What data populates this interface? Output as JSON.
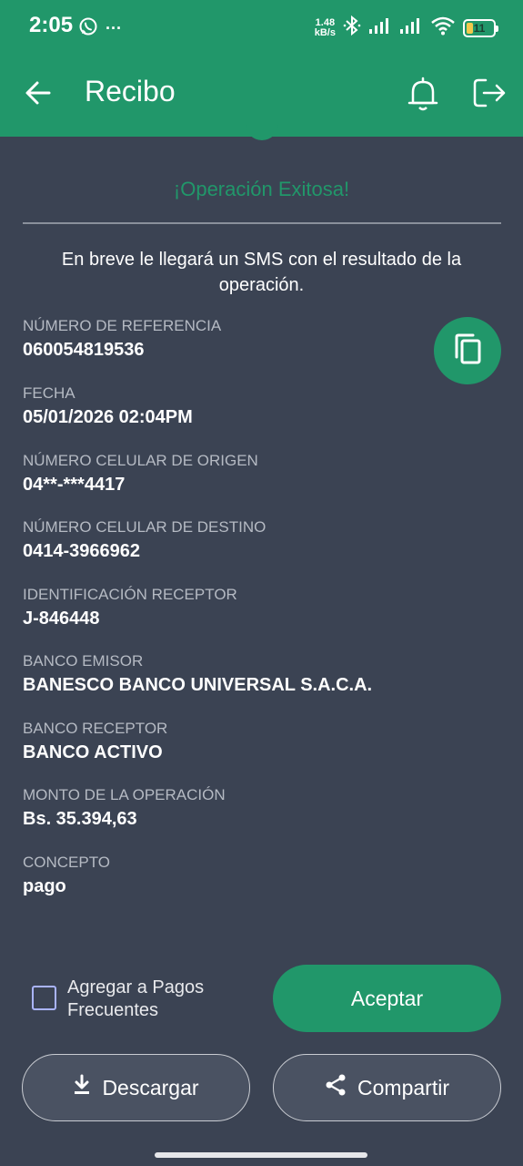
{
  "status_bar": {
    "time": "2:05",
    "more": "···",
    "net_speed_value": "1.48",
    "net_speed_unit": "kB/s",
    "battery_level": "11",
    "icons": [
      "whatsapp-icon",
      "bluetooth-icon",
      "signal-icon",
      "signal-icon",
      "wifi-icon",
      "battery-icon"
    ]
  },
  "app_bar": {
    "title": "Recibo",
    "icons": [
      "back-arrow-icon",
      "bell-icon",
      "logout-icon"
    ]
  },
  "receipt": {
    "success_title": "¡Operación Exitosa!",
    "sms_note": "En breve le llegará un SMS con el resultado de la operación.",
    "fields": [
      {
        "label": "NÚMERO DE REFERENCIA",
        "value": "060054819536"
      },
      {
        "label": "FECHA",
        "value": "05/01/2026 02:04PM"
      },
      {
        "label": "NÚMERO CELULAR DE ORIGEN",
        "value": "04**-***4417"
      },
      {
        "label": "NÚMERO CELULAR DE DESTINO",
        "value": "0414-3966962"
      },
      {
        "label": "IDENTIFICACIÓN RECEPTOR",
        "value": "J-846448"
      },
      {
        "label": "BANCO EMISOR",
        "value": "BANESCO BANCO UNIVERSAL S.A.C.A."
      },
      {
        "label": "BANCO RECEPTOR",
        "value": "BANCO ACTIVO"
      },
      {
        "label": "MONTO DE LA OPERACIÓN",
        "value": "Bs. 35.394,63"
      },
      {
        "label": "CONCEPTO",
        "value": "pago"
      }
    ]
  },
  "actions": {
    "frequent_payments_label": "Agregar a Pagos Frecuentes",
    "frequent_payments_checked": false,
    "accept_label": "Aceptar",
    "download_label": "Descargar",
    "share_label": "Compartir"
  },
  "colors": {
    "brand_green": "#21976a",
    "background": "#3b4353",
    "label_gray": "#b5bac3"
  }
}
